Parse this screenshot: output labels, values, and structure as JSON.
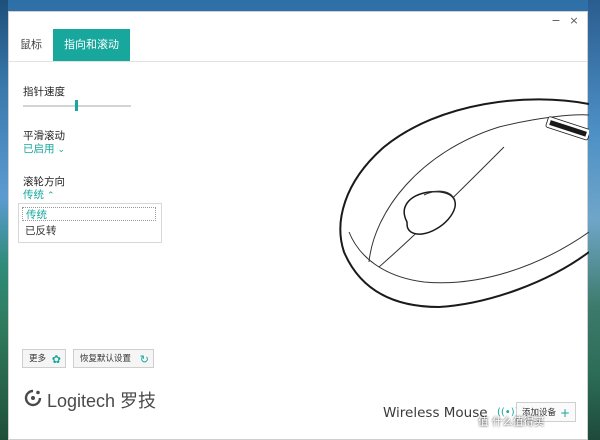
{
  "window": {
    "minimize_symbol": "−",
    "close_symbol": "×"
  },
  "tabs": [
    {
      "label": "鼠标",
      "active": false
    },
    {
      "label": "指向和滚动",
      "active": true
    }
  ],
  "settings": {
    "pointer_speed": {
      "label": "指针速度",
      "value_fraction": 0.5
    },
    "smooth_scroll": {
      "label": "平滑滚动",
      "value": "已启用"
    },
    "scroll_direction": {
      "label": "滚轮方向",
      "value": "传统",
      "options": [
        "传统",
        "已反转"
      ]
    }
  },
  "footer": {
    "more_label": "更多",
    "reset_label": "恢复默认设置",
    "brand_text": "Logitech 罗技",
    "brand_mark": "·",
    "device_name": "Wireless Mouse",
    "add_device_label": "添加设备"
  },
  "icons": {
    "more": "gear-icon",
    "reset": "refresh-icon",
    "wireless": "wireless-signal-icon",
    "add": "plus-icon"
  },
  "colors": {
    "accent": "#17a79c"
  },
  "watermark": "值 什么值得买"
}
